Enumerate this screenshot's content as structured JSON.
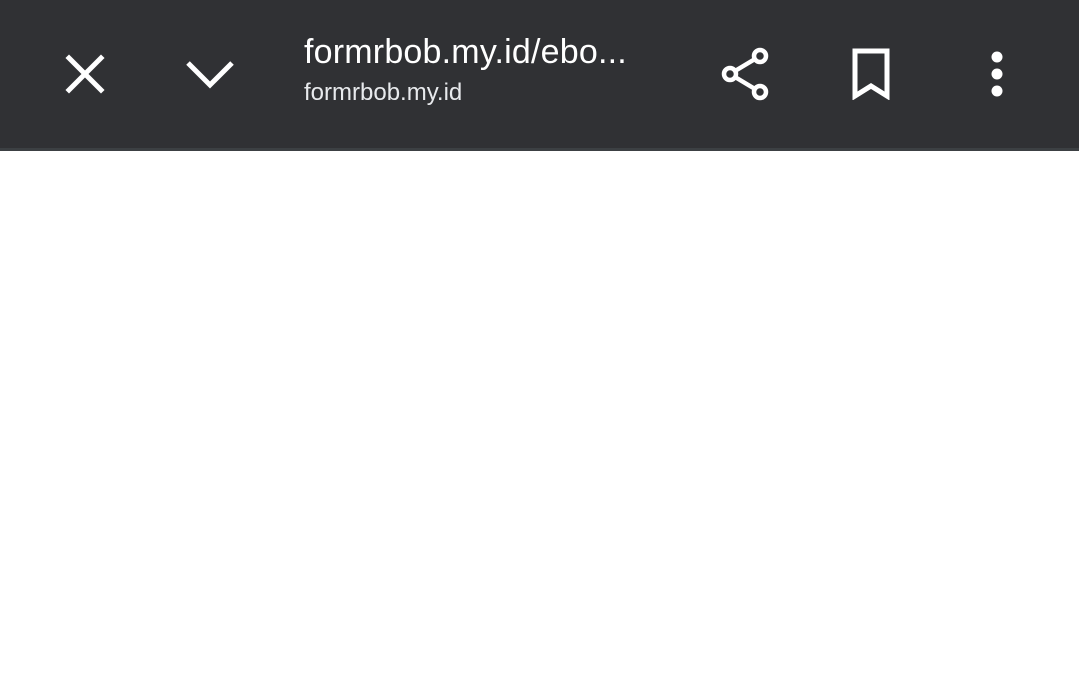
{
  "toolbar": {
    "title": "formrbob.my.id/ebo...",
    "domain": "formrbob.my.id",
    "background_color": "#303134",
    "icons": {
      "close": "close-icon",
      "minimize": "chevron-down-icon",
      "share": "share-icon",
      "bookmark": "bookmark-icon",
      "menu": "more-vert-icon"
    }
  },
  "page": {
    "background_color": "#ffffff"
  }
}
